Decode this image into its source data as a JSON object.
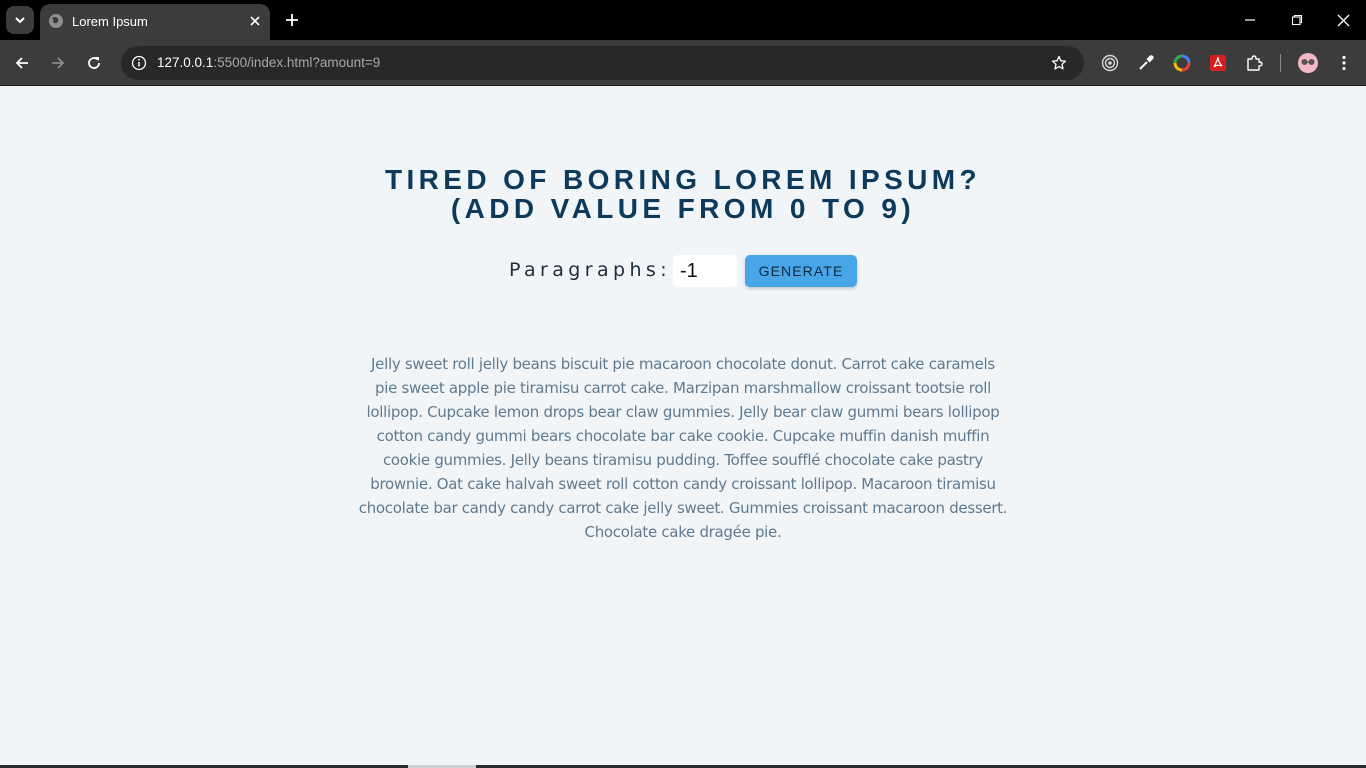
{
  "tab": {
    "title": "Lorem Ipsum"
  },
  "address_bar": {
    "host": "127.0.0.1",
    "path": ":5500/index.html?amount=9"
  },
  "icons": {
    "tab_search": "chevron-down-icon",
    "favicon": "globe-icon",
    "tab_close": "close-icon",
    "new_tab": "plus-icon",
    "minimize": "minimize-icon",
    "restore": "restore-icon",
    "close_window": "close-icon",
    "back": "arrow-left-icon",
    "forward": "arrow-right-icon",
    "reload": "reload-icon",
    "site_info": "info-icon",
    "bookmark": "star-icon",
    "extensions": [
      "target-icon",
      "eyedropper-icon",
      "color-wheel-icon",
      "pdf-icon",
      "puzzle-icon"
    ],
    "profile": "avatar-icon",
    "menu": "kebab-menu-icon"
  },
  "page": {
    "heading_line1": "TIRED OF BORING LOREM IPSUM?",
    "heading_line2": "(ADD VALUE FROM 0 TO 9)",
    "paragraphs_label": "Paragraphs:",
    "amount_value": "-1",
    "generate_label": "GENERATE",
    "lorem_text": "Jelly sweet roll jelly beans biscuit pie macaroon chocolate donut. Carrot cake caramels pie sweet apple pie tiramisu carrot cake. Marzipan marshmallow croissant tootsie roll lollipop. Cupcake lemon drops bear claw gummies. Jelly bear claw gummi bears lollipop cotton candy gummi bears chocolate bar cake cookie. Cupcake muffin danish muffin cookie gummies. Jelly beans tiramisu pudding. Toffee soufflé chocolate cake pastry brownie. Oat cake halvah sweet roll cotton candy croissant lollipop. Macaroon tiramisu chocolate bar candy candy carrot cake jelly sweet. Gummies croissant macaroon dessert. Chocolate cake dragée pie."
  },
  "colors": {
    "heading": "#0d3a5a",
    "button": "#48a6e8",
    "background": "#f1f5f8",
    "text": "#5f7a90"
  }
}
